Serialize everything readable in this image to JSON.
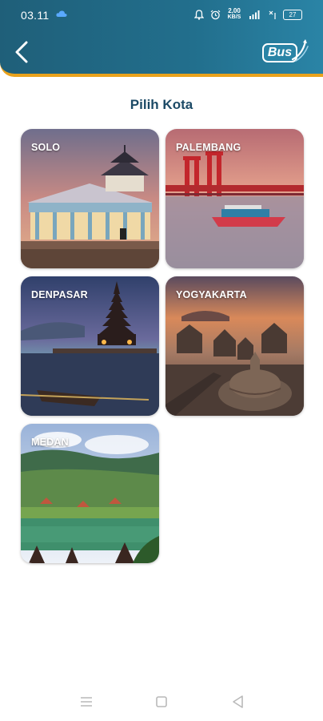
{
  "status_bar": {
    "time": "03.11",
    "net_speed_value": "2,00",
    "net_speed_unit": "KB/S",
    "battery": "27"
  },
  "header": {
    "logo_text": "Bus"
  },
  "page": {
    "title": "Pilih Kota"
  },
  "cities": [
    {
      "label": "SOLO"
    },
    {
      "label": "PALEMBANG"
    },
    {
      "label": "DENPASAR"
    },
    {
      "label": "YOGYAKARTA"
    },
    {
      "label": "MEDAN"
    }
  ],
  "colors": {
    "header_teal": "#226f8d",
    "header_accent": "#e9a21c",
    "title_text": "#1c4a66"
  },
  "icons": {
    "back": "chevron-left-icon",
    "nav_recents": "menu-lines-icon",
    "nav_home": "square-icon",
    "nav_back": "triangle-back-icon"
  }
}
